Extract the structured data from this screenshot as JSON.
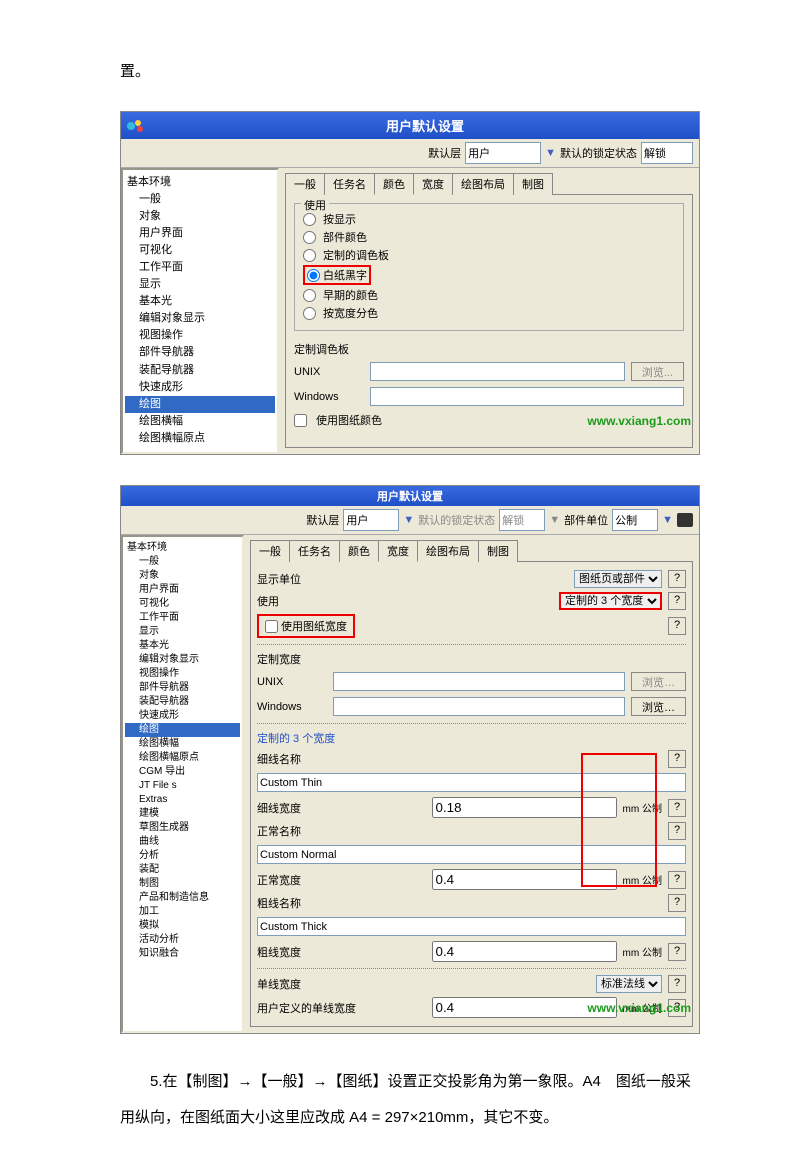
{
  "intro_fragment": "置。",
  "watermark": "www.vxiang1.com",
  "dialog1": {
    "title": "用户默认设置",
    "toolbar": {
      "layer_label": "默认层",
      "layer_value": "用户",
      "lock_label": "默认的锁定状态",
      "lock_value": "解锁"
    },
    "tree": [
      "基本环境",
      "一般",
      "对象",
      "用户界面",
      "可视化",
      "工作平面",
      "显示",
      "基本光",
      "编辑对象显示",
      "视图操作",
      "部件导航器",
      "装配导航器",
      "快速成形",
      "绘图",
      "绘图横幅",
      "绘图横幅原点"
    ],
    "tree_selected_index": 13,
    "tabs": [
      "一般",
      "任务名",
      "颜色",
      "宽度",
      "绘图布局",
      "制图"
    ],
    "active_tab": 2,
    "use_group": {
      "legend": "使用",
      "radios": [
        "按显示",
        "部件颜色",
        "定制的调色板",
        "白纸黑字",
        "早期的颜色",
        "按宽度分色"
      ],
      "highlighted_index": 3
    },
    "palette_group": {
      "legend": "定制调色板",
      "unix": "UNIX",
      "windows": "Windows",
      "browse": "浏览...",
      "checkbox": "使用图纸颜色"
    }
  },
  "dialog2": {
    "title": "用户默认设置",
    "toolbar": {
      "layer_label": "默认层",
      "layer_value": "用户",
      "lock_label": "默认的锁定状态",
      "lock_value": "解锁",
      "unit_label": "部件单位",
      "unit_value": "公制"
    },
    "tree_root": "基本环境",
    "tree": [
      "一般",
      "对象",
      "用户界面",
      "可视化",
      "工作平面",
      "显示",
      "基本光",
      "编辑对象显示",
      "视图操作",
      "部件导航器",
      "装配导航器",
      "快速成形",
      "绘图",
      "绘图横幅",
      "绘图横幅原点",
      "CGM 导出",
      "JT File s",
      "Extras",
      "建模",
      "草图生成器",
      "曲线",
      "分析",
      "装配",
      "制图",
      "产品和制造信息",
      "加工",
      "模拟",
      "活动分析",
      "知识融合"
    ],
    "selected": "绘图",
    "tabs": [
      "一般",
      "任务名",
      "颜色",
      "宽度",
      "绘图布局",
      "制图"
    ],
    "active_tab": 3,
    "rows": {
      "display_unit_label": "显示单位",
      "display_unit_value": "图纸页或部件",
      "use_label": "使用",
      "use_value": "定制的 3 个宽度",
      "use_paper_width_cb": "使用图纸宽度",
      "custom_palette": "定制宽度",
      "unix": "UNIX",
      "windows": "Windows",
      "browse": "浏览…",
      "three_widths_header": "定制的 3 个宽度",
      "thin_name_label": "细线名称",
      "thin_name": "Custom Thin",
      "thin_width_label": "细线宽度",
      "thin_width": "0.18",
      "unit_suffix": "mm 公制",
      "normal_name_label": "正常名称",
      "normal_name": "Custom Normal",
      "normal_width_label": "正常宽度",
      "normal_width": "0.4",
      "thick_name_label": "粗线名称",
      "thick_name": "Custom Thick",
      "thick_width_label": "粗线宽度",
      "thick_width": "0.4",
      "single_width_label": "单线宽度",
      "single_width_value": "标准法线",
      "user_def_label": "用户定义的单线宽度",
      "user_def_value": "0.4"
    }
  },
  "body_text": "5.在【制图】→【一般】→【图纸】设置正交投影角为第一象限。A4　图纸一般采用纵向，在图纸面大小这里应改成 A4 = 297×210mm，其它不变。"
}
